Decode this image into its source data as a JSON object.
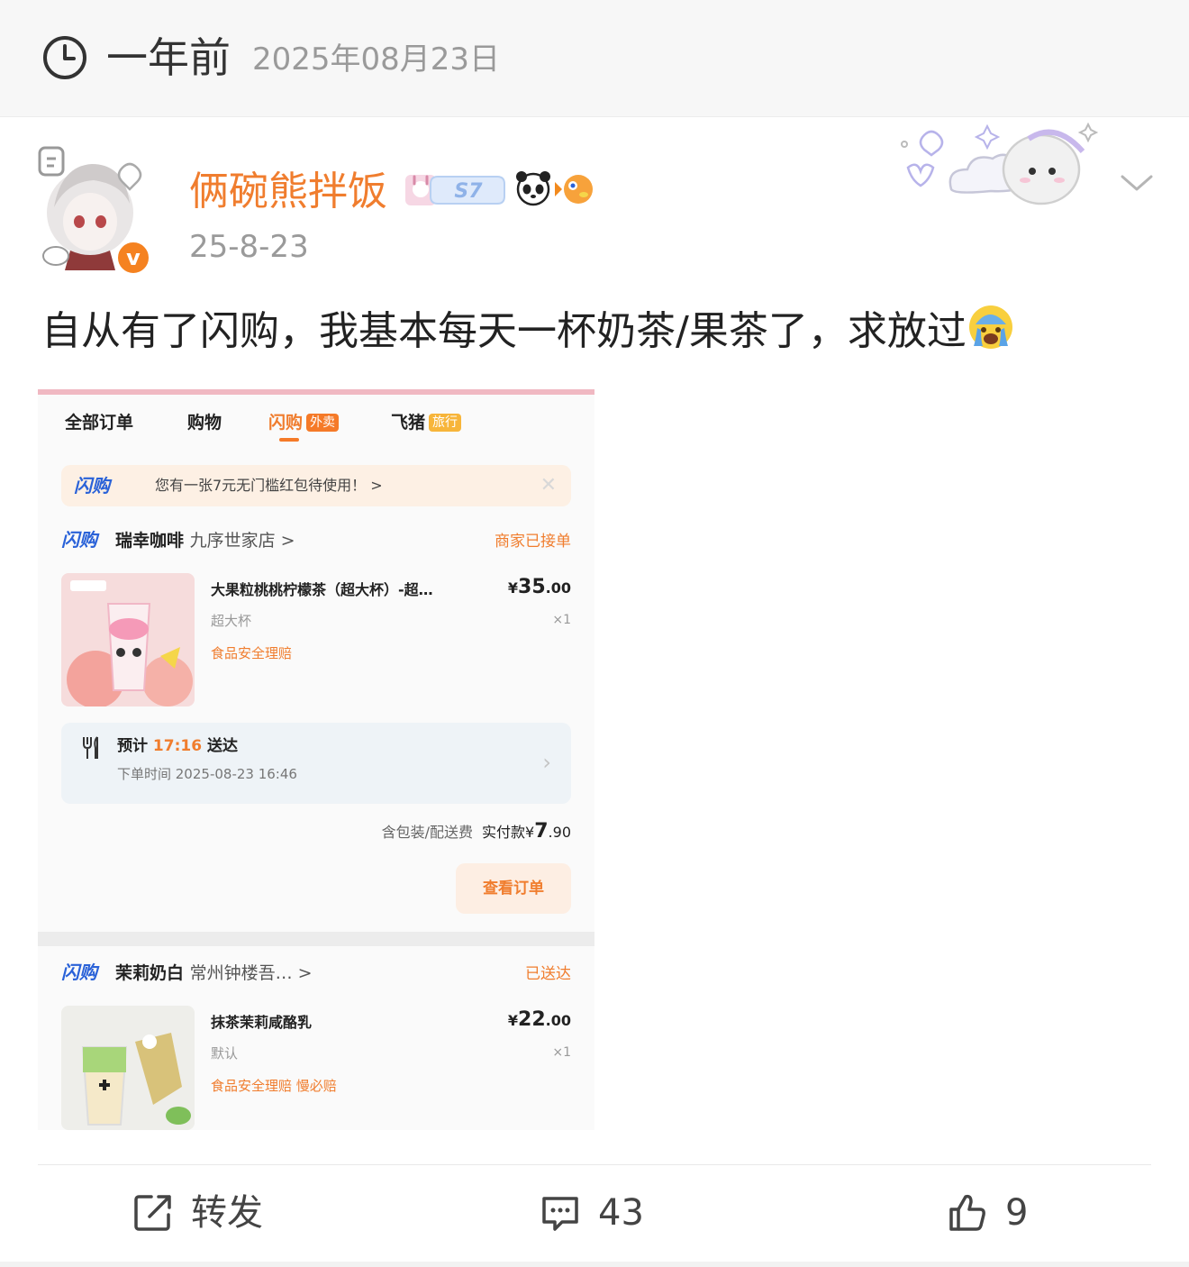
{
  "header": {
    "relative_time": "一年前",
    "full_date": "2025年08月23日",
    "clock_icon": "clock-icon"
  },
  "post": {
    "username": "俩碗熊拌饭",
    "level_badge": "S7",
    "verified_badge": "v",
    "time": "25-8-23",
    "text": "自从有了闪购，我基本每天一杯奶茶/果茶了，求放过",
    "emoji": "crying-emoji"
  },
  "screenshot": {
    "tabs": [
      {
        "label": "全部订单"
      },
      {
        "label": "购物"
      },
      {
        "label": "闪购",
        "tag": "外卖"
      },
      {
        "label": "飞猪",
        "tag": "旅行"
      }
    ],
    "brand_logo": "闪购",
    "promo": {
      "text": "您有一张7元无门槛红包待使用！ >",
      "close": "✕"
    },
    "order1": {
      "store": "瑞幸咖啡",
      "branch": "九序世家店 >",
      "status": "商家已接单",
      "item_name": "大果粒桃桃柠檬茶（超大杯）-超…",
      "price_symbol": "¥",
      "price_int": "35",
      "price_dec": ".00",
      "spec": "超大杯",
      "qty": "×1",
      "insurance": "食品安全理赔",
      "eta_label": "预计",
      "eta_time": "17:16",
      "eta_suffix": "送达",
      "order_time": "下单时间 2025-08-23 16:46",
      "arrow": "›",
      "total_label": "含包装/配送费",
      "paid_label": "实付款¥",
      "paid_int": "7",
      "paid_dec": ".90",
      "view_button": "查看订单"
    },
    "order2": {
      "store": "茉莉奶白",
      "branch": "常州钟楼吾… >",
      "status": "已送达",
      "item_name": "抹茶茉莉咸酪乳",
      "price_symbol": "¥",
      "price_int": "22",
      "price_dec": ".00",
      "spec": "默认",
      "qty": "×1",
      "insurance": "食品安全理赔  慢必赔"
    }
  },
  "actions": {
    "repost": "转发",
    "comments": "43",
    "likes": "9"
  },
  "colors": {
    "brand_orange": "#f07d2e",
    "shangou_blue": "#2a62d8"
  }
}
